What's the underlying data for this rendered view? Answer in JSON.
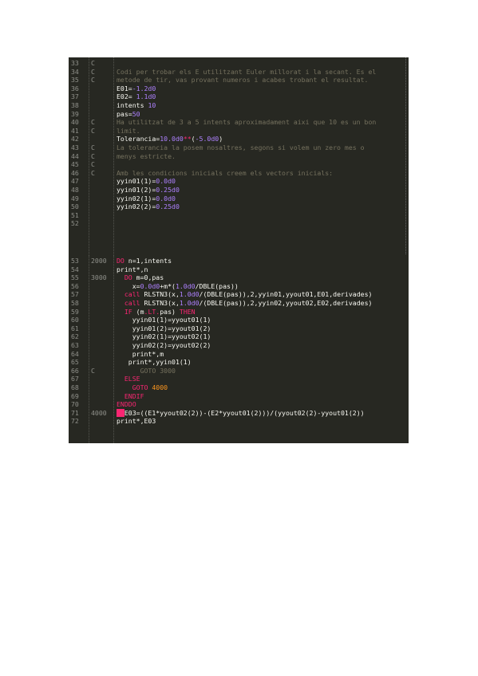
{
  "panels": [
    {
      "id": "panel1",
      "lines": [
        {
          "n": "33",
          "label": "C",
          "tokens": [
            {
              "t": "comment",
              "v": ""
            }
          ]
        },
        {
          "n": "34",
          "label": "C",
          "tokens": [
            {
              "t": "comment",
              "v": "Codi per trobar els E utilitzant Euler millorat i la secant. Es el"
            }
          ]
        },
        {
          "n": "35",
          "label": "C",
          "tokens": [
            {
              "t": "comment",
              "v": "metode de tir, vas provant numeros i acabes trobant el resultat."
            }
          ]
        },
        {
          "n": "36",
          "label": "",
          "tokens": [
            {
              "t": "plain",
              "v": "E01="
            },
            {
              "t": "number",
              "v": "-1.2d0"
            }
          ]
        },
        {
          "n": "37",
          "label": "",
          "tokens": [
            {
              "t": "plain",
              "v": "E02= "
            },
            {
              "t": "number",
              "v": "1.1d0"
            }
          ]
        },
        {
          "n": "38",
          "label": "",
          "tokens": [
            {
              "t": "plain",
              "v": "intents "
            },
            {
              "t": "number",
              "v": "10"
            }
          ]
        },
        {
          "n": "39",
          "label": "",
          "tokens": [
            {
              "t": "plain",
              "v": "pas="
            },
            {
              "t": "number",
              "v": "50"
            }
          ]
        },
        {
          "n": "40",
          "label": "C",
          "tokens": [
            {
              "t": "comment",
              "v": "Ha utilitzat de 3 a 5 intents aproximadament aixi que 10 es un bon"
            }
          ]
        },
        {
          "n": "41",
          "label": "C",
          "tokens": [
            {
              "t": "comment",
              "v": "limit."
            }
          ]
        },
        {
          "n": "42",
          "label": "",
          "tokens": [
            {
              "t": "plain",
              "v": "Tolerancia="
            },
            {
              "t": "number",
              "v": "10.0d0"
            },
            {
              "t": "keyword",
              "v": "**"
            },
            {
              "t": "plain",
              "v": "("
            },
            {
              "t": "number",
              "v": "-5.0d0"
            },
            {
              "t": "plain",
              "v": ")"
            }
          ]
        },
        {
          "n": "43",
          "label": "C",
          "tokens": [
            {
              "t": "comment",
              "v": "La tolerancia la posem nosaltres, segons si volem un zero mes o"
            }
          ]
        },
        {
          "n": "44",
          "label": "C",
          "tokens": [
            {
              "t": "comment",
              "v": "menys estricte."
            }
          ]
        },
        {
          "n": "45",
          "label": "C",
          "tokens": [
            {
              "t": "comment",
              "v": ""
            }
          ]
        },
        {
          "n": "46",
          "label": "C",
          "tokens": [
            {
              "t": "comment",
              "v": "Amb les condicions inicials creem els vectors inicials:"
            }
          ]
        },
        {
          "n": "47",
          "label": "",
          "tokens": [
            {
              "t": "plain",
              "v": "yyin01(1)="
            },
            {
              "t": "number",
              "v": "0.0d0"
            }
          ]
        },
        {
          "n": "48",
          "label": "",
          "tokens": [
            {
              "t": "plain",
              "v": "yyin01(2)="
            },
            {
              "t": "number",
              "v": "0.25d0"
            }
          ]
        },
        {
          "n": "49",
          "label": "",
          "tokens": [
            {
              "t": "plain",
              "v": "yyin02(1)="
            },
            {
              "t": "number",
              "v": "0.0d0"
            }
          ]
        },
        {
          "n": "50",
          "label": "",
          "tokens": [
            {
              "t": "plain",
              "v": "yyin02(2)="
            },
            {
              "t": "number",
              "v": "0.25d0"
            }
          ]
        },
        {
          "n": "51",
          "label": "",
          "tokens": [
            {
              "t": "plain",
              "v": ""
            }
          ]
        },
        {
          "n": "52",
          "label": "",
          "tokens": [
            {
              "t": "plain",
              "v": ""
            }
          ]
        }
      ]
    },
    {
      "id": "panel2",
      "lines": [
        {
          "n": "53",
          "label": "2000",
          "tokens": [
            {
              "t": "keyword",
              "v": "DO "
            },
            {
              "t": "plain",
              "v": "n=1,intents"
            }
          ]
        },
        {
          "n": "54",
          "label": "",
          "tokens": [
            {
              "t": "plain",
              "v": "print*,n"
            }
          ]
        },
        {
          "n": "55",
          "label": "3000",
          "tokens": [
            {
              "t": "plain",
              "v": "  "
            },
            {
              "t": "keyword",
              "v": "DO "
            },
            {
              "t": "plain",
              "v": "m=0,pas"
            }
          ]
        },
        {
          "n": "56",
          "label": "",
          "tokens": [
            {
              "t": "plain",
              "v": "    x="
            },
            {
              "t": "number",
              "v": "0.0d0"
            },
            {
              "t": "plain",
              "v": "+m*("
            },
            {
              "t": "number",
              "v": "1.0d0"
            },
            {
              "t": "plain",
              "v": "/DBLE(pas))"
            }
          ]
        },
        {
          "n": "57",
          "label": "",
          "tokens": [
            {
              "t": "plain",
              "v": "  "
            },
            {
              "t": "keyword",
              "v": "call "
            },
            {
              "t": "plain",
              "v": "RLSTN3(x,"
            },
            {
              "t": "number",
              "v": "1.0d0"
            },
            {
              "t": "plain",
              "v": "/(DBLE(pas)),2,yyin01,yyout01,E01,derivades)"
            }
          ]
        },
        {
          "n": "58",
          "label": "",
          "tokens": [
            {
              "t": "plain",
              "v": "  "
            },
            {
              "t": "keyword",
              "v": "call "
            },
            {
              "t": "plain",
              "v": "RLSTN3(x,"
            },
            {
              "t": "number",
              "v": "1.0d0"
            },
            {
              "t": "plain",
              "v": "/(DBLE(pas)),2,yyin02,yyout02,E02,derivades)"
            }
          ]
        },
        {
          "n": "59",
          "label": "",
          "tokens": [
            {
              "t": "plain",
              "v": "  "
            },
            {
              "t": "keyword",
              "v": "IF "
            },
            {
              "t": "plain",
              "v": "(m"
            },
            {
              "t": "keyword",
              "v": ".LT."
            },
            {
              "t": "plain",
              "v": "pas) "
            },
            {
              "t": "keyword",
              "v": "THEN"
            }
          ]
        },
        {
          "n": "60",
          "label": "",
          "tokens": [
            {
              "t": "plain",
              "v": "    yyin01(1)=yyout01(1)"
            }
          ]
        },
        {
          "n": "61",
          "label": "",
          "tokens": [
            {
              "t": "plain",
              "v": "    yyin01(2)=yyout01(2)"
            }
          ]
        },
        {
          "n": "62",
          "label": "",
          "tokens": [
            {
              "t": "plain",
              "v": "    yyin02(1)=yyout02(1)"
            }
          ]
        },
        {
          "n": "63",
          "label": "",
          "tokens": [
            {
              "t": "plain",
              "v": "    yyin02(2)=yyout02(2)"
            }
          ]
        },
        {
          "n": "64",
          "label": "",
          "tokens": [
            {
              "t": "plain",
              "v": "    print*,m"
            }
          ]
        },
        {
          "n": "65",
          "label": "",
          "tokens": [
            {
              "t": "plain",
              "v": "   print*,yyin01(1)"
            }
          ]
        },
        {
          "n": "66",
          "label": "C",
          "tokens": [
            {
              "t": "comment",
              "v": "      GOTO 3000"
            }
          ]
        },
        {
          "n": "67",
          "label": "",
          "tokens": [
            {
              "t": "plain",
              "v": "  "
            },
            {
              "t": "keyword",
              "v": "ELSE"
            }
          ]
        },
        {
          "n": "68",
          "label": "",
          "tokens": [
            {
              "t": "plain",
              "v": "    "
            },
            {
              "t": "keyword",
              "v": "GOTO "
            },
            {
              "t": "orange",
              "v": "4000"
            }
          ]
        },
        {
          "n": "69",
          "label": "",
          "tokens": [
            {
              "t": "plain",
              "v": "  "
            },
            {
              "t": "keyword",
              "v": "ENDIF"
            }
          ]
        },
        {
          "n": "70",
          "label": "",
          "tokens": [
            {
              "t": "keyword",
              "v": "ENDDO"
            }
          ]
        },
        {
          "n": "71",
          "label": "4000",
          "tokens": [
            {
              "t": "cursor",
              "v": "  "
            },
            {
              "t": "plain",
              "v": "E03=((E1*yyout02(2))-(E2*yyout01(2)))/(yyout02(2)-yyout01(2))"
            }
          ]
        },
        {
          "n": "72",
          "label": "",
          "tokens": [
            {
              "t": "plain",
              "v": "print*,E03"
            }
          ]
        }
      ]
    }
  ]
}
